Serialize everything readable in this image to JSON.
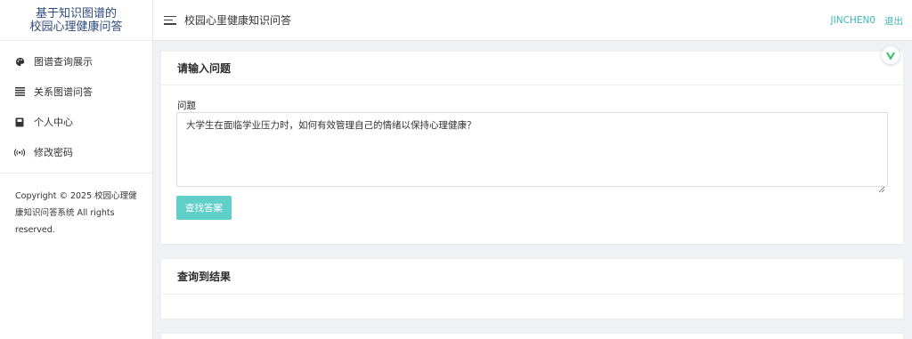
{
  "brand": {
    "line1": "基于知识图谱的",
    "line2": "校园心理健康问答"
  },
  "sidebar": {
    "items": [
      {
        "label": "图谱查询展示",
        "icon": "palette-icon"
      },
      {
        "label": "关系图谱问答",
        "icon": "list-icon"
      },
      {
        "label": "个人中心",
        "icon": "book-icon"
      },
      {
        "label": "修改密码",
        "icon": "broadcast-icon"
      }
    ],
    "copyright_lines": [
      "Copyright © 2025 校园心理健",
      "康知识问答系统 All rights",
      "reserved."
    ]
  },
  "topbar": {
    "title": "校园心里健康知识问答",
    "username": "JINCHEN0",
    "logout": "退出"
  },
  "question_card": {
    "header": "请输入问题",
    "field_label": "问题",
    "question_value": "大学生在面临学业压力时，如何有效管理自己的情绪以保持心理健康？",
    "button_label": "查找答案"
  },
  "result_card": {
    "header": "查询到结果"
  },
  "colors": {
    "accent": "#3cb9b4",
    "button": "#5fcfc8",
    "brand": "#2e4a7d"
  }
}
